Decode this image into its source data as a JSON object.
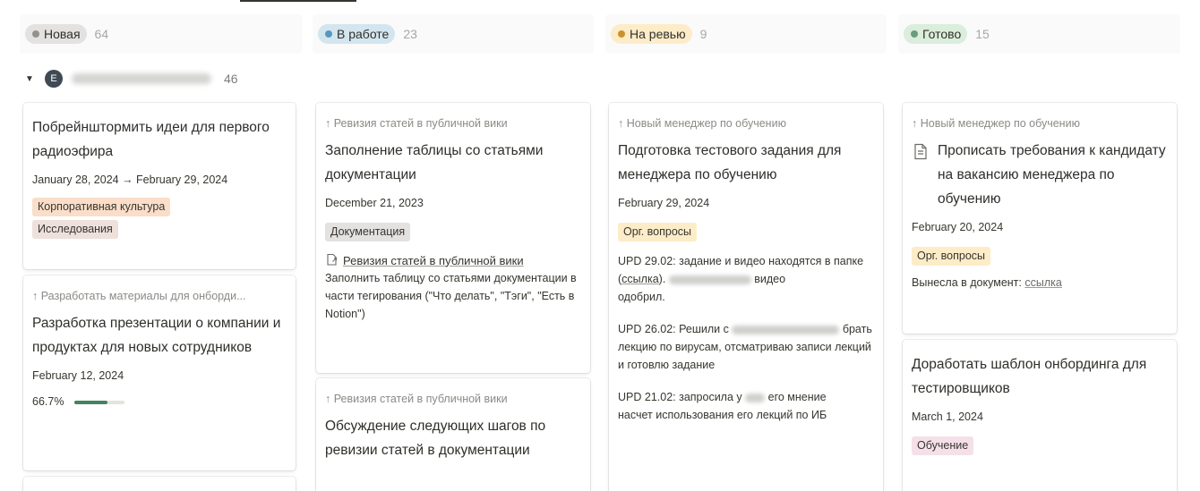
{
  "columns": [
    {
      "label": "Новая",
      "count": "64",
      "dot_color": "#91918e",
      "pill_bg": "#e3e2e0"
    },
    {
      "label": "В работе",
      "count": "23",
      "dot_color": "#5b97bd",
      "pill_bg": "#d3e5ef"
    },
    {
      "label": "На ревью",
      "count": "9",
      "dot_color": "#cb912f",
      "pill_bg": "#fdecc8"
    },
    {
      "label": "Готово",
      "count": "15",
      "dot_color": "#6c9b7d",
      "pill_bg": "#dbeddb"
    }
  ],
  "group": {
    "avatar_letter": "E",
    "count": "46"
  },
  "cards": {
    "c1": {
      "title": "Побрейнштормить идеи для первого радиоэфира",
      "date": "January 28, 2024 → February 29, 2024",
      "tags": [
        "Корпоративная культура",
        "Исследования"
      ]
    },
    "c2": {
      "parent": "↑ Разработать материалы для онборди...",
      "title": "Разработка презентации о компании и продуктах для новых сотрудников",
      "date": "February 12, 2024",
      "progress_label": "66.7%",
      "progress_value": 0.667
    },
    "c3": {
      "parent": "↑ Ревизия статей в публичной вики",
      "title": "Заполнение таблицы со статьями документации",
      "date": "December 21, 2023",
      "tag": "Документация",
      "link_title": "Ревизия статей в публичной вики",
      "link_desc": "Заполнить таблицу со статьями документации в части тегирования (\"Что делать\", \"Тэги\", \"Есть в Notion\")"
    },
    "c4": {
      "parent": "↑ Ревизия статей в публичной вики",
      "title": "Обсуждение следующих шагов по ревизии статей в документации"
    },
    "c5": {
      "parent": "↑ Новый менеджер по обучению",
      "title": "Подготовка тестового задания для менеджера по обучению",
      "date": "February 29, 2024",
      "tag": "Орг. вопросы",
      "upd1_a": "UPD 29.02: задание и видео находятся в папке (",
      "upd1_link": "ссылка",
      "upd1_b": ").",
      "upd1_c": "видео",
      "upd1_d": "одобрил.",
      "upd2_a": "UPD 26.02: Решили с",
      "upd2_b": "брать лекцию по вирусам, отсматриваю записи лекций и готовлю задание",
      "upd3_a": "UPD 21.02: запросила у",
      "upd3_b": "его мнение",
      "upd3_c": "насчет использования его лекций по ИБ"
    },
    "c6": {
      "parent": "↑ Новый менеджер по обучению",
      "title": "Прописать требования к кандидату на вакансию менеджера по обучению",
      "date": "February 20, 2024",
      "tag": "Орг. вопросы",
      "note": "Вынесла в документ:",
      "note_link": "ссылка"
    },
    "c7": {
      "title": "Доработать шаблон онбординга для тестировщиков",
      "date": "March 1, 2024",
      "tag": "Обучение"
    }
  },
  "tag_colors": {
    "orange": "#fadec9",
    "brown": "#eee0da",
    "gray": "#e3e2e0",
    "yellow": "#fdecc8",
    "pink": "#f5e0e9"
  },
  "icons": {
    "collapse": "triangle-down-icon",
    "subitem": "arrow-up-icon",
    "page": "page-icon",
    "linked": "linked-page-icon"
  }
}
